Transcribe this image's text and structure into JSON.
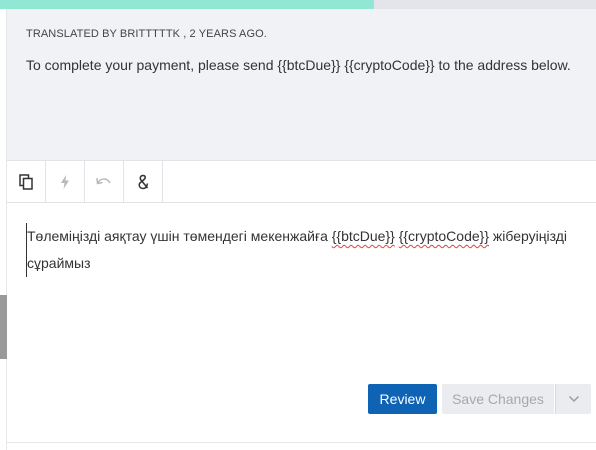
{
  "progress": {
    "fraction": 0.628,
    "fill_color": "#8fe7d4",
    "track_color": "#e4e5ea"
  },
  "source": {
    "meta": "TRANSLATED BY BRITTTTTK , 2 YEARS AGO.",
    "text": "To complete your payment, please send {{btcDue}} {{cryptoCode}} to the address below."
  },
  "toolbar": {
    "tools": [
      {
        "icon": "copy-source-icon",
        "enabled": true
      },
      {
        "icon": "lightning-icon",
        "enabled": false
      },
      {
        "icon": "undo-icon",
        "enabled": false
      },
      {
        "icon": "special-character-icon",
        "enabled": true
      }
    ]
  },
  "editor": {
    "text_before": "Төлеміңізді аяқтау үшін төмендегі мекенжайға ",
    "placeholder_1": "{{btcDue}}",
    "placeholder_2": "{{cryptoCode}}",
    "text_after": " жіберуіңізді сұраймыз"
  },
  "actions": {
    "review_label": "Review",
    "save_label": "Save Changes",
    "review_color": "#0e63b4"
  }
}
